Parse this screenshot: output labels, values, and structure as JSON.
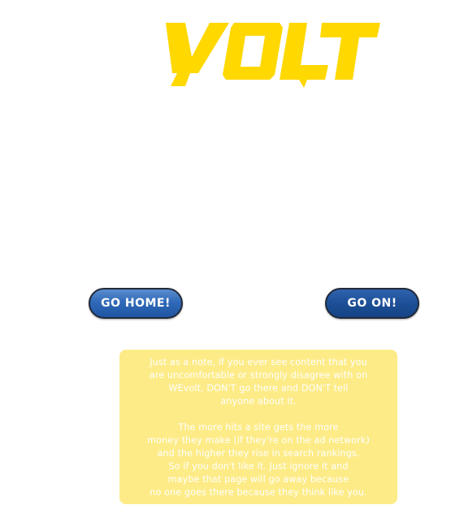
{
  "logo": {
    "text": "VOLT",
    "color": "#ffd800"
  },
  "buttons": {
    "home_label": "GO HOME!",
    "on_label": "GO ON!"
  },
  "note": {
    "background": "#fdeb87",
    "paragraph1": [
      "Just as a note, if you ever see content that you",
      "are uncomfortable or strongly disagree with on",
      "WEvolt, DON'T go there and DON'T tell",
      "anyone about it."
    ],
    "paragraph2": [
      "The more hits a site gets the more",
      "money they make (if they're on the ad network)",
      "and the higher they rise in search rankings.",
      "So if you don't like it. Just ignore it and",
      "maybe that page will go away because",
      "no one goes there because they think like you."
    ]
  }
}
